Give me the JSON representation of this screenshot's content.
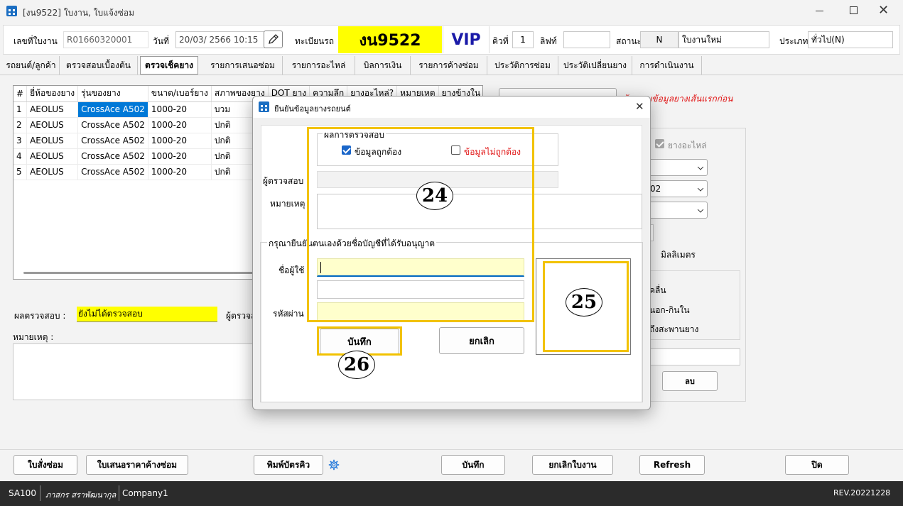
{
  "window": {
    "title": "[งน9522] ใบงาน, ใบแจ้งซ่อม",
    "icon": "app-grid-icon"
  },
  "header": {
    "job_no_label": "เลขที่ใบงาน",
    "job_no_value": "R01660320001",
    "date_label": "วันที่",
    "date_value": "20/03/  2566 10:15",
    "plate_label": "ทะเบียนรถ",
    "plate_value": "งน9522",
    "vip": "VIP",
    "queue_label": "คิวที่",
    "queue_value": "1",
    "lift_label": "ลิฟท์",
    "lift_value": "",
    "status_label": "สถานะ",
    "status_code": "N",
    "status_text": "ใบงานใหม่",
    "type_label": "ประเภท",
    "type_value": "ทั่วไป(N)"
  },
  "tabs": [
    "รถยนต์/ลูกค้า",
    "ตรวจสอบเบื้องต้น",
    "ตรวจเช็คยาง",
    "รายการเสนอซ่อม",
    "รายการอะไหล่",
    "บิลการเงิน",
    "รายการค้างซ่อม",
    "ประวัติการซ่อม",
    "ประวัติเปลี่ยนยาง",
    "การดำเนินงาน"
  ],
  "tire_grid": {
    "columns": [
      "#",
      "ยี่ห้อของยาง",
      "รุ่นของยาง",
      "ขนาด/เบอร์ยาง",
      "สภาพของยาง",
      "DOT ยาง",
      "ความลึก",
      "ยางอะไหล่?",
      "หมายเหตุ",
      "ยางข้างใน"
    ],
    "rows": [
      [
        "1",
        "AEOLUS",
        "CrossAce A502",
        "1000-20",
        "บวม"
      ],
      [
        "2",
        "AEOLUS",
        "CrossAce A502",
        "1000-20",
        "ปกติ"
      ],
      [
        "3",
        "AEOLUS",
        "CrossAce A502",
        "1000-20",
        "ปกติ"
      ],
      [
        "4",
        "AEOLUS",
        "CrossAce A502",
        "1000-20",
        "ปกติ"
      ],
      [
        "5",
        "AEOLUS",
        "CrossAce A502",
        "1000-20",
        "ปกติ"
      ]
    ]
  },
  "right_panel": {
    "warning": "ต้องระบุข้อมูลยางเส้นแรกก่อน",
    "spare_check": "ยางอะไหล่",
    "combo2": "02",
    "unit": "มิลลิเมตร",
    "opt1": "คลื่น",
    "opt2": "นอก-กินใน",
    "opt3": "ถึงสะพานยาง",
    "delete_btn": "ลบ"
  },
  "main_form": {
    "result_label": "ผลตรวจสอบ :",
    "result_value": "ยังไม่ได้ตรวจสอบ",
    "inspector_label": "ผู้ตรวจส",
    "remark_label": "หมายเหตุ :"
  },
  "dialog": {
    "title": "ยืนยันข้อมูลยางรถยนต์",
    "group_result": "ผลการตรวจสอบ",
    "ok_label": "ข้อมูลถูกต้อง",
    "ok_checked": true,
    "bad_label": "ข้อมูลไม่ถูกต้อง",
    "bad_checked": false,
    "inspector_label": "ผู้ตรวจสอบ :",
    "remark_label": "หมายเหตุ",
    "auth_group": "กรุณายืนยันตนเองด้วยชื่อบัญชีที่ได้รับอนุญาต",
    "username_label": "ชื่อผู้ใช้",
    "password_label": "รหัสผ่าน",
    "save_btn": "บันทึก",
    "cancel_btn": "ยกเลิก"
  },
  "callouts": {
    "c24": "24",
    "c25": "25",
    "c26": "26",
    "color": "#f2c200"
  },
  "bottom_buttons": {
    "repair_order": "ใบสั่งซ่อม",
    "quote_pending": "ใบเสนอราคาค้างซ่อม",
    "print_queue": "พิมพ์บัตรคิว",
    "save": "บันทึก",
    "cancel_job": "ยกเลิกใบงาน",
    "refresh": "Refresh",
    "close": "ปิด"
  },
  "statusbar": {
    "code": "SA100",
    "user": "ภาสกร สราพัฒนากุล",
    "company": "Company1",
    "rev": "REV.20221228"
  },
  "colors": {
    "plate_bg": "#ffff00",
    "vip_text": "#1a1aa8",
    "accent": "#0067c0",
    "selection": "#0078d7",
    "status_bar": "#2b2b2b"
  }
}
